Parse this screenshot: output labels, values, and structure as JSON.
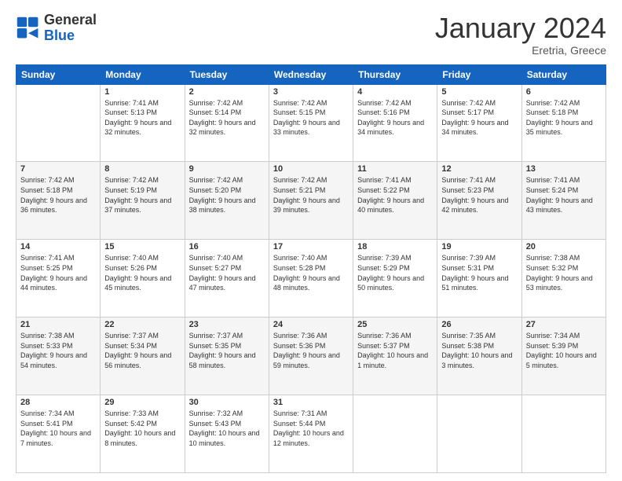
{
  "header": {
    "logo_general": "General",
    "logo_blue": "Blue",
    "month_title": "January 2024",
    "location": "Eretria, Greece"
  },
  "days_of_week": [
    "Sunday",
    "Monday",
    "Tuesday",
    "Wednesday",
    "Thursday",
    "Friday",
    "Saturday"
  ],
  "weeks": [
    [
      {
        "day": "",
        "sunrise": "",
        "sunset": "",
        "daylight": ""
      },
      {
        "day": "1",
        "sunrise": "Sunrise: 7:41 AM",
        "sunset": "Sunset: 5:13 PM",
        "daylight": "Daylight: 9 hours and 32 minutes."
      },
      {
        "day": "2",
        "sunrise": "Sunrise: 7:42 AM",
        "sunset": "Sunset: 5:14 PM",
        "daylight": "Daylight: 9 hours and 32 minutes."
      },
      {
        "day": "3",
        "sunrise": "Sunrise: 7:42 AM",
        "sunset": "Sunset: 5:15 PM",
        "daylight": "Daylight: 9 hours and 33 minutes."
      },
      {
        "day": "4",
        "sunrise": "Sunrise: 7:42 AM",
        "sunset": "Sunset: 5:16 PM",
        "daylight": "Daylight: 9 hours and 34 minutes."
      },
      {
        "day": "5",
        "sunrise": "Sunrise: 7:42 AM",
        "sunset": "Sunset: 5:17 PM",
        "daylight": "Daylight: 9 hours and 34 minutes."
      },
      {
        "day": "6",
        "sunrise": "Sunrise: 7:42 AM",
        "sunset": "Sunset: 5:18 PM",
        "daylight": "Daylight: 9 hours and 35 minutes."
      }
    ],
    [
      {
        "day": "7",
        "sunrise": "Sunrise: 7:42 AM",
        "sunset": "Sunset: 5:18 PM",
        "daylight": "Daylight: 9 hours and 36 minutes."
      },
      {
        "day": "8",
        "sunrise": "Sunrise: 7:42 AM",
        "sunset": "Sunset: 5:19 PM",
        "daylight": "Daylight: 9 hours and 37 minutes."
      },
      {
        "day": "9",
        "sunrise": "Sunrise: 7:42 AM",
        "sunset": "Sunset: 5:20 PM",
        "daylight": "Daylight: 9 hours and 38 minutes."
      },
      {
        "day": "10",
        "sunrise": "Sunrise: 7:42 AM",
        "sunset": "Sunset: 5:21 PM",
        "daylight": "Daylight: 9 hours and 39 minutes."
      },
      {
        "day": "11",
        "sunrise": "Sunrise: 7:41 AM",
        "sunset": "Sunset: 5:22 PM",
        "daylight": "Daylight: 9 hours and 40 minutes."
      },
      {
        "day": "12",
        "sunrise": "Sunrise: 7:41 AM",
        "sunset": "Sunset: 5:23 PM",
        "daylight": "Daylight: 9 hours and 42 minutes."
      },
      {
        "day": "13",
        "sunrise": "Sunrise: 7:41 AM",
        "sunset": "Sunset: 5:24 PM",
        "daylight": "Daylight: 9 hours and 43 minutes."
      }
    ],
    [
      {
        "day": "14",
        "sunrise": "Sunrise: 7:41 AM",
        "sunset": "Sunset: 5:25 PM",
        "daylight": "Daylight: 9 hours and 44 minutes."
      },
      {
        "day": "15",
        "sunrise": "Sunrise: 7:40 AM",
        "sunset": "Sunset: 5:26 PM",
        "daylight": "Daylight: 9 hours and 45 minutes."
      },
      {
        "day": "16",
        "sunrise": "Sunrise: 7:40 AM",
        "sunset": "Sunset: 5:27 PM",
        "daylight": "Daylight: 9 hours and 47 minutes."
      },
      {
        "day": "17",
        "sunrise": "Sunrise: 7:40 AM",
        "sunset": "Sunset: 5:28 PM",
        "daylight": "Daylight: 9 hours and 48 minutes."
      },
      {
        "day": "18",
        "sunrise": "Sunrise: 7:39 AM",
        "sunset": "Sunset: 5:29 PM",
        "daylight": "Daylight: 9 hours and 50 minutes."
      },
      {
        "day": "19",
        "sunrise": "Sunrise: 7:39 AM",
        "sunset": "Sunset: 5:31 PM",
        "daylight": "Daylight: 9 hours and 51 minutes."
      },
      {
        "day": "20",
        "sunrise": "Sunrise: 7:38 AM",
        "sunset": "Sunset: 5:32 PM",
        "daylight": "Daylight: 9 hours and 53 minutes."
      }
    ],
    [
      {
        "day": "21",
        "sunrise": "Sunrise: 7:38 AM",
        "sunset": "Sunset: 5:33 PM",
        "daylight": "Daylight: 9 hours and 54 minutes."
      },
      {
        "day": "22",
        "sunrise": "Sunrise: 7:37 AM",
        "sunset": "Sunset: 5:34 PM",
        "daylight": "Daylight: 9 hours and 56 minutes."
      },
      {
        "day": "23",
        "sunrise": "Sunrise: 7:37 AM",
        "sunset": "Sunset: 5:35 PM",
        "daylight": "Daylight: 9 hours and 58 minutes."
      },
      {
        "day": "24",
        "sunrise": "Sunrise: 7:36 AM",
        "sunset": "Sunset: 5:36 PM",
        "daylight": "Daylight: 9 hours and 59 minutes."
      },
      {
        "day": "25",
        "sunrise": "Sunrise: 7:36 AM",
        "sunset": "Sunset: 5:37 PM",
        "daylight": "Daylight: 10 hours and 1 minute."
      },
      {
        "day": "26",
        "sunrise": "Sunrise: 7:35 AM",
        "sunset": "Sunset: 5:38 PM",
        "daylight": "Daylight: 10 hours and 3 minutes."
      },
      {
        "day": "27",
        "sunrise": "Sunrise: 7:34 AM",
        "sunset": "Sunset: 5:39 PM",
        "daylight": "Daylight: 10 hours and 5 minutes."
      }
    ],
    [
      {
        "day": "28",
        "sunrise": "Sunrise: 7:34 AM",
        "sunset": "Sunset: 5:41 PM",
        "daylight": "Daylight: 10 hours and 7 minutes."
      },
      {
        "day": "29",
        "sunrise": "Sunrise: 7:33 AM",
        "sunset": "Sunset: 5:42 PM",
        "daylight": "Daylight: 10 hours and 8 minutes."
      },
      {
        "day": "30",
        "sunrise": "Sunrise: 7:32 AM",
        "sunset": "Sunset: 5:43 PM",
        "daylight": "Daylight: 10 hours and 10 minutes."
      },
      {
        "day": "31",
        "sunrise": "Sunrise: 7:31 AM",
        "sunset": "Sunset: 5:44 PM",
        "daylight": "Daylight: 10 hours and 12 minutes."
      },
      {
        "day": "",
        "sunrise": "",
        "sunset": "",
        "daylight": ""
      },
      {
        "day": "",
        "sunrise": "",
        "sunset": "",
        "daylight": ""
      },
      {
        "day": "",
        "sunrise": "",
        "sunset": "",
        "daylight": ""
      }
    ]
  ]
}
